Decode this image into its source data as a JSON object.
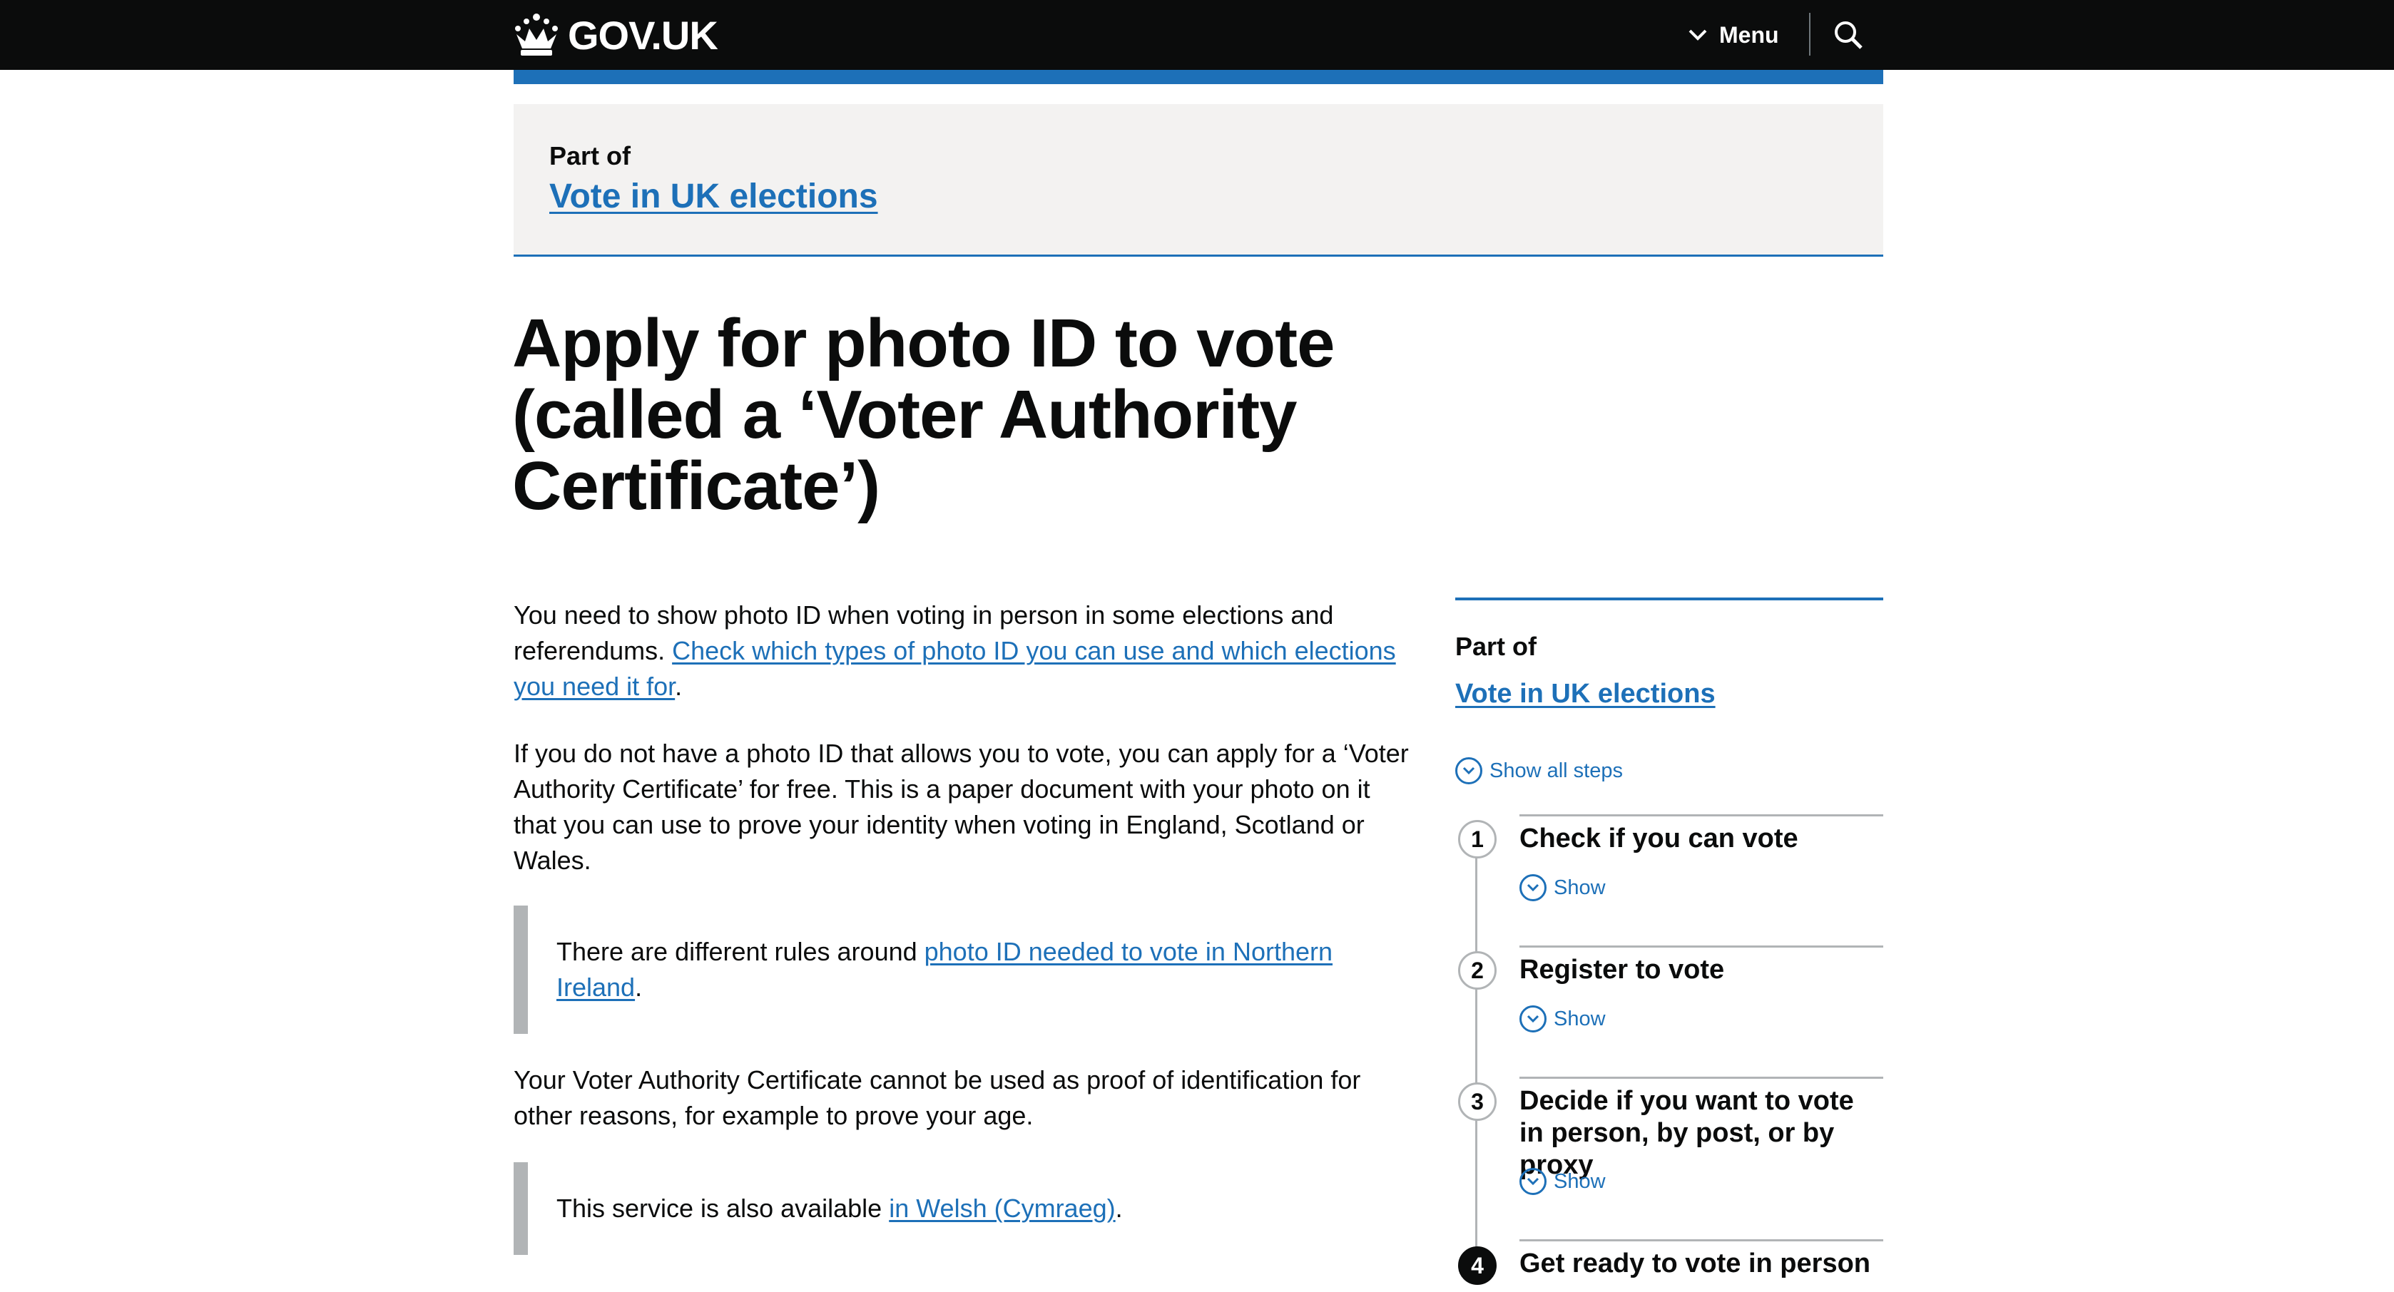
{
  "header": {
    "logo_text": "GOV.UK",
    "menu_label": "Menu",
    "icons": {
      "logo": "crown-icon",
      "menu": "chevron-down-icon",
      "search": "search-icon"
    }
  },
  "colors": {
    "header_bg": "#0b0c0c",
    "link": "#1d70b8",
    "panel_bg": "#f3f2f1",
    "inset_border": "#b1b4b6"
  },
  "part_of": {
    "label": "Part of",
    "link": "Vote in UK elections"
  },
  "title": {
    "line1": "Apply for photo ID to vote",
    "line2": "(called a ‘Voter Authority",
    "line3": "Certificate’)"
  },
  "content": {
    "p1_text": "You need to show photo ID when voting in person in some elections and referendums. ",
    "p1_link": "Check which types of photo ID you can use and which elections you need it for",
    "p1_end": ".",
    "p2": "If you do not have a photo ID that allows you to vote, you can apply for a ‘Voter Authority Certificate’ for free. This is a paper document with your photo on it that you can use to prove your identity when voting in England, Scotland or Wales.",
    "inset1_text": "There are different rules around ",
    "inset1_link": "photo ID needed to vote in Northern Ireland",
    "inset1_end": ".",
    "p3": "Your Voter Authority Certificate cannot be used as proof of identification for other reasons, for example to prove your age.",
    "inset2_text": "This service is also available ",
    "inset2_link": "in Welsh (Cymraeg)",
    "inset2_end": "."
  },
  "sidebar": {
    "part_of_label": "Part of",
    "part_of_link": "Vote in UK elections",
    "show_all": "Show all steps",
    "steps": [
      {
        "number": "1",
        "title": "Check if you can vote",
        "show": "Show"
      },
      {
        "number": "2",
        "title": "Register to vote",
        "show": "Show"
      },
      {
        "number": "3",
        "title": "Decide if you want to vote in person, by post, or by proxy",
        "show": "Show"
      },
      {
        "number": "4",
        "title": "Get ready to vote in person"
      }
    ]
  }
}
